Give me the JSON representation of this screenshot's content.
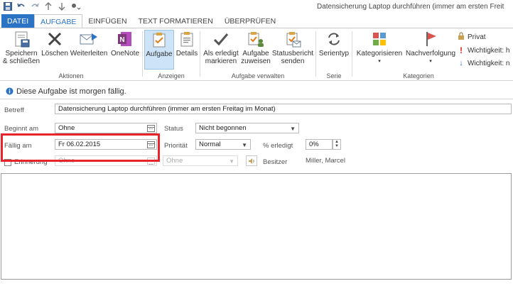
{
  "window_title": "Datensicherung Laptop durchführen (immer am ersten Freit",
  "qat": {
    "icons": [
      "save-icon",
      "undo-icon",
      "redo-icon",
      "up-arrow-icon",
      "down-arrow-icon",
      "customize-icon"
    ]
  },
  "tabs": [
    {
      "label": "DATEI"
    },
    {
      "label": "AUFGABE"
    },
    {
      "label": "EINFÜGEN"
    },
    {
      "label": "TEXT FORMATIEREN"
    },
    {
      "label": "ÜBERPRÜFEN"
    }
  ],
  "ribbon": {
    "aktionen": {
      "label": "Aktionen",
      "save_close_1": "Speichern",
      "save_close_2": "& schließen",
      "delete": "Löschen",
      "forward": "Weiterleiten",
      "onenote": "OneNote"
    },
    "anzeigen": {
      "label": "Anzeigen",
      "task": "Aufgabe",
      "details": "Details"
    },
    "verwalten": {
      "label": "Aufgabe verwalten",
      "mark_done_1": "Als erledigt",
      "mark_done_2": "markieren",
      "assign_1": "Aufgabe",
      "assign_2": "zuweisen",
      "report_1": "Statusbericht",
      "report_2": "senden"
    },
    "serie": {
      "label": "Serie",
      "recurrence": "Serientyp"
    },
    "kategorien": {
      "label": "Kategorien",
      "categorize": "Kategorisieren",
      "followup": "Nachverfolgung",
      "private": "Privat",
      "high": "Wichtigkeit: h",
      "low": "Wichtigkeit: n"
    }
  },
  "infobar": {
    "text": "Diese Aufgabe ist morgen fällig."
  },
  "form": {
    "subject_label": "Betreff",
    "subject_value": "Datensicherung Laptop durchführen (immer am ersten Freitag im Monat)",
    "start_label": "Beginnt am",
    "start_value": "Ohne",
    "due_label": "Fällig am",
    "due_value": "Fr 06.02.2015",
    "reminder_label": "Erinnerung",
    "reminder_date": "Ohne",
    "reminder_time": "Ohne",
    "status_label": "Status",
    "status_value": "Nicht begonnen",
    "priority_label": "Priorität",
    "priority_value": "Normal",
    "percent_label": "% erledigt",
    "percent_value": "0%",
    "owner_label": "Besitzer",
    "owner_value": "Miller, Marcel"
  },
  "colors": {
    "accent": "#2b73c4",
    "highlight": "#e8242a"
  }
}
